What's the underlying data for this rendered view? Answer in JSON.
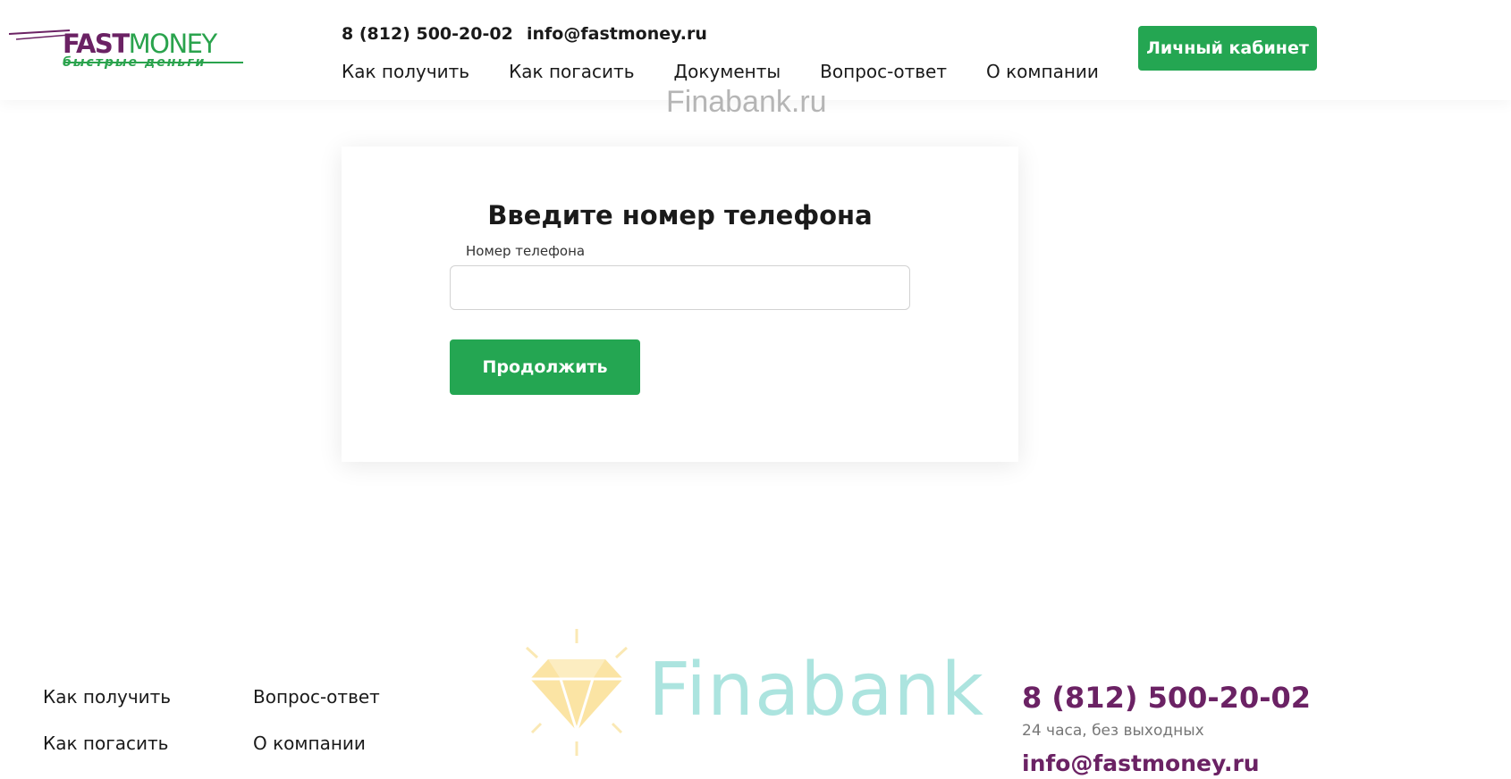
{
  "header": {
    "logo": {
      "main_left": "FAST",
      "main_right": "MONEY",
      "tagline": "быстрые деньги"
    },
    "phone": "8 (812) 500-20-02",
    "email": "info@fastmoney.ru",
    "nav": [
      "Как получить",
      "Как погасить",
      "Документы",
      "Вопрос-ответ",
      "О компании"
    ],
    "cabinet_button": "Личный кабинет"
  },
  "watermark": {
    "top_text": "Finabank.ru",
    "bottom_text": "Finabank"
  },
  "form": {
    "title": "Введите номер телефона",
    "phone_label": "Номер телефона",
    "phone_value": "",
    "continue_button": "Продолжить"
  },
  "footer": {
    "links": [
      "Как получить",
      "Вопрос-ответ",
      "Как погасить",
      "О компании"
    ],
    "phone": "8 (812) 500-20-02",
    "hours": "24 часа, без выходных",
    "email": "info@fastmoney.ru"
  },
  "colors": {
    "brand_green": "#24a652",
    "brand_purple": "#6b2264"
  }
}
